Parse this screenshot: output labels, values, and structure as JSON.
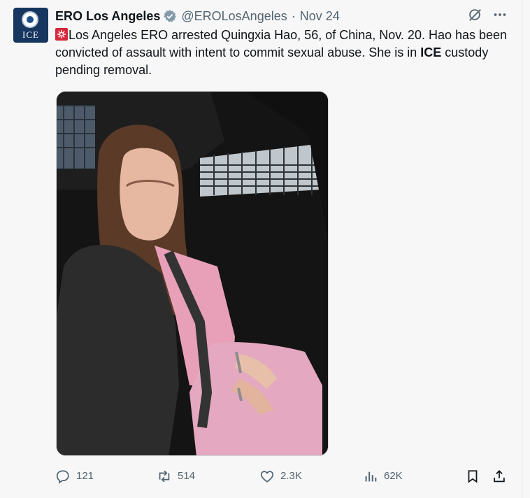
{
  "author": {
    "name": "ERO Los Angeles",
    "handle": "@EROLosAngeles",
    "separator": "·",
    "date": "Nov 24",
    "avatar_text": "ICE"
  },
  "post": {
    "text_part1": "Los Angeles ERO arrested Quingxia Hao, 56, of China, Nov. 20. Hao has been convicted of assault with intent to commit sexual abuse. She is in ",
    "text_bold": "ICE",
    "text_part2": " custody pending removal."
  },
  "metrics": {
    "replies": "121",
    "reposts": "514",
    "likes": "2.3K",
    "views": "62K"
  },
  "icons": {
    "verified": "verified-badge-icon",
    "grok": "grok-icon",
    "more": "more-icon",
    "siren": "siren-emoji-icon",
    "reply": "reply-icon",
    "repost": "repost-icon",
    "like": "heart-icon",
    "views": "views-icon",
    "bookmark": "bookmark-icon",
    "share": "share-icon"
  },
  "colors": {
    "verified": "#829aab",
    "muted": "#536471",
    "text": "#0f1419",
    "avatar_bg": "#16355f"
  }
}
